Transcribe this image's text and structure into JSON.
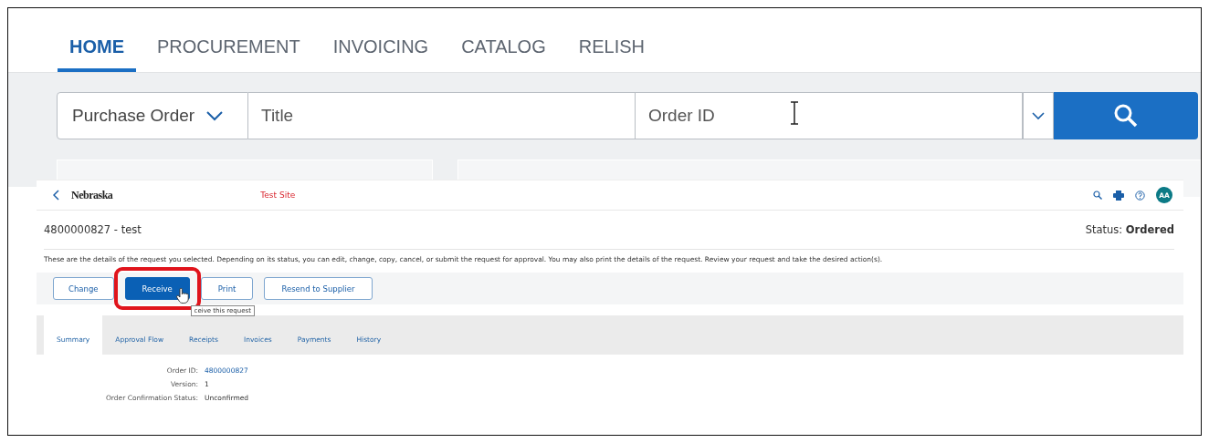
{
  "nav": {
    "tabs": [
      {
        "label": "HOME",
        "selected": true
      },
      {
        "label": "PROCUREMENT",
        "selected": false
      },
      {
        "label": "INVOICING",
        "selected": false
      },
      {
        "label": "CATALOG",
        "selected": false
      },
      {
        "label": "RELISH",
        "selected": false
      }
    ]
  },
  "search": {
    "type": "Purchase Order",
    "title_placeholder": "Title",
    "order_placeholder": "Order ID"
  },
  "detail": {
    "logo": "Nebraska",
    "site": "Test Site",
    "avatar": "AA",
    "title": "4800000827 - test",
    "status": "Status: **Ordered**",
    "description": "These are the details of the request you selected. Depending on its status, you can edit, change, copy, cancel, or submit the request for approval. You may also print the details of the request. Review your request and take the desired action(s).",
    "buttons": [
      {
        "label": "Change",
        "kind": "secondary",
        "highlighted": false
      },
      {
        "label": "Receive",
        "kind": "primary",
        "highlighted": true
      },
      {
        "label": "Print",
        "kind": "secondary",
        "highlighted": false
      },
      {
        "label": "Resend to Supplier",
        "kind": "secondary",
        "highlighted": false
      }
    ],
    "tooltip": "ceive this request",
    "tabs": [
      {
        "label": "Summary",
        "selected": true
      },
      {
        "label": "Approval Flow",
        "selected": false
      },
      {
        "label": "Receipts",
        "selected": false
      },
      {
        "label": "Invoices",
        "selected": false
      },
      {
        "label": "Payments",
        "selected": false
      },
      {
        "label": "History",
        "selected": false
      }
    ],
    "fields": [
      {
        "label": "Order ID:",
        "value": "4800000827",
        "kind": "link"
      },
      {
        "label": "Version:",
        "value": "1",
        "kind": "plain"
      },
      {
        "label": "Order Confirmation Status:",
        "value": "Unconfirmed",
        "kind": "plain"
      }
    ]
  }
}
